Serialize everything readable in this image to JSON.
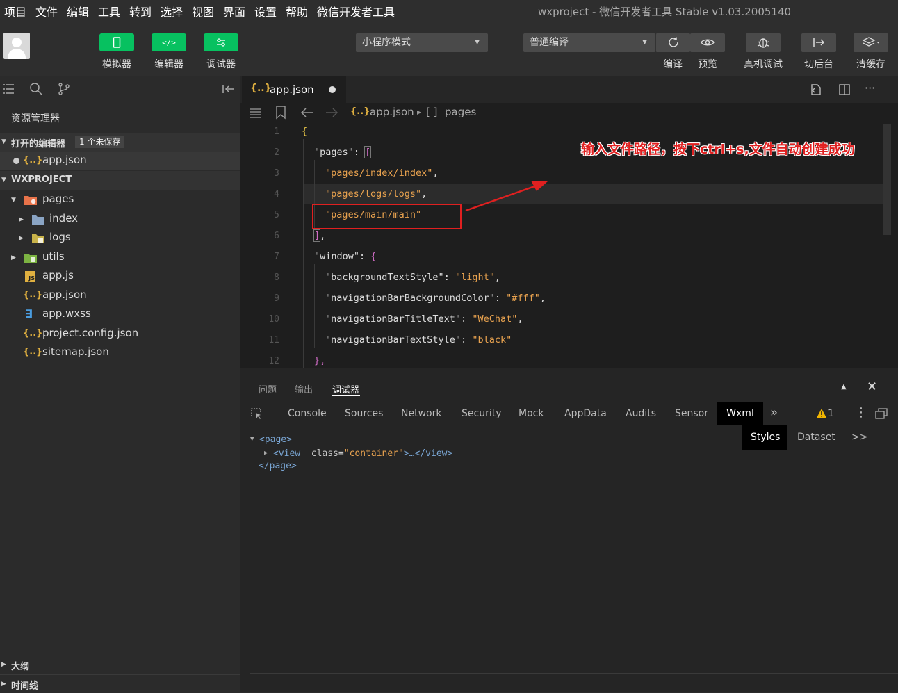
{
  "menubar": {
    "items": [
      "项目",
      "文件",
      "编辑",
      "工具",
      "转到",
      "选择",
      "视图",
      "界面",
      "设置",
      "帮助",
      "微信开发者工具"
    ],
    "title": "wxproject - 微信开发者工具 Stable v1.03.2005140"
  },
  "toolbar": {
    "simulator_label": "模拟器",
    "editor_label": "编辑器",
    "debugger_label": "调试器",
    "mode_value": "小程序模式",
    "compile_value": "普通编译",
    "compile_label": "编译",
    "preview_label": "预览",
    "remote_debug_label": "真机调试",
    "background_label": "切后台",
    "clear_cache_label": "清缓存",
    "accent": "#07c160"
  },
  "sidebar": {
    "title": "资源管理器",
    "open_editors": {
      "label": "打开的编辑器",
      "badge": "1 个未保存",
      "file": "app.json"
    },
    "project": {
      "label": "WXPROJECT",
      "tree": [
        {
          "name": "pages",
          "icon": "folder-icon"
        },
        {
          "name": "index",
          "icon": "folder-icon"
        },
        {
          "name": "logs",
          "icon": "folder-icon"
        },
        {
          "name": "utils",
          "icon": "folder-icon"
        },
        {
          "name": "app.js",
          "icon": "js-file-icon"
        },
        {
          "name": "app.json",
          "icon": "json-file-icon"
        },
        {
          "name": "app.wxss",
          "icon": "css-file-icon"
        },
        {
          "name": "project.config.json",
          "icon": "json-file-icon"
        },
        {
          "name": "sitemap.json",
          "icon": "json-file-icon"
        }
      ]
    },
    "outline_label": "大纲",
    "timeline_label": "时间线"
  },
  "editor": {
    "tab_label": "app.json",
    "breadcrumb": {
      "file": "app.json",
      "node": "pages"
    },
    "line_numbers": [
      "1",
      "2",
      "3",
      "4",
      "5",
      "6",
      "7",
      "8",
      "9",
      "10",
      "11",
      "12"
    ],
    "lines": {
      "l1": "{",
      "l2_key": "\"pages\"",
      "l2_rest": ": ",
      "l2_bracket": "[",
      "l3": "\"pages/index/index\"",
      "l4": "\"pages/logs/logs\"",
      "l5": "\"pages/main/main\"",
      "l6": "]",
      "l6b": ",",
      "l7_key": "\"window\"",
      "l7_rest": ": ",
      "l7_brace": "{",
      "l8_key": "\"backgroundTextStyle\"",
      "l8_val": "\"light\"",
      "l9_key": "\"navigationBarBackgroundColor\"",
      "l9_val": "\"#fff\"",
      "l10_key": "\"navigationBarTitleText\"",
      "l10_val": "\"WeChat\"",
      "l11_key": "\"navigationBarTextStyle\"",
      "l11_val": "\"black\"",
      "l12": "},",
      "colon_sep": ": ",
      "comma": ","
    },
    "annotation": "输入文件路径，按下ctrl+s,文件自动创建成功"
  },
  "devtools": {
    "top_tabs": [
      "问题",
      "输出",
      "调试器"
    ],
    "tabs": [
      "Console",
      "Sources",
      "Network",
      "Security",
      "Mock",
      "AppData",
      "Audits",
      "Sensor",
      "Wxml"
    ],
    "more": "»",
    "warning_count": "1",
    "dom": {
      "page_open": "<page>",
      "view_open": "<view",
      "view_attr": "class=",
      "view_val": "\"container\"",
      "view_close": ">…</view>",
      "page_close": "</page>"
    },
    "styles_tabs": [
      "Styles",
      "Dataset",
      ">>"
    ]
  }
}
